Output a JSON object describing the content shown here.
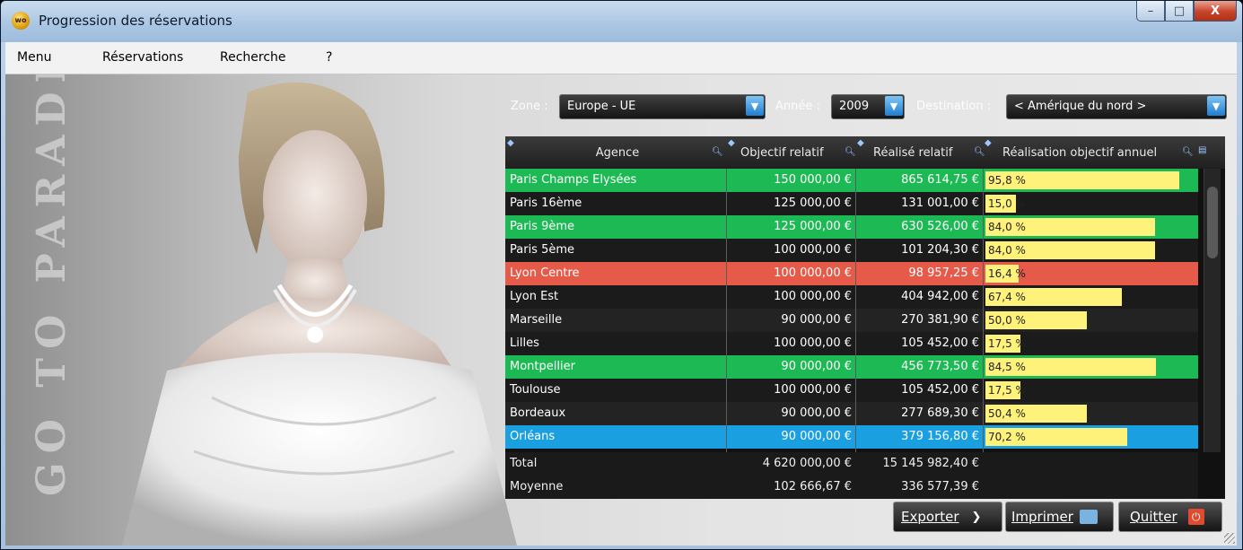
{
  "window": {
    "title": "Progression des réservations",
    "app_icon_text": "wo",
    "controls": {
      "minimize": "–",
      "maximize": "□",
      "close": "X"
    }
  },
  "menu": [
    "Menu",
    "Réservations",
    "Recherche",
    "?"
  ],
  "background": {
    "vertical_text": "GO TO PARADISE"
  },
  "filters": {
    "zone_label": "Zone :",
    "zone_value": "Europe - UE",
    "year_label": "Année :",
    "year_value": "2009",
    "destination_label": "Destination :",
    "destination_value": "< Amérique du nord >"
  },
  "table": {
    "columns": [
      "Agence",
      "Objectif relatif",
      "Réalisé relatif",
      "Réalisation objectif annuel"
    ],
    "rows": [
      {
        "agency": "Paris Champs Elysées",
        "objective": "150 000,00 €",
        "realized": "865 614,75 €",
        "pct": "95,8 %",
        "pct_value": 95.8,
        "status": "green"
      },
      {
        "agency": "Paris 16ème",
        "objective": "125 000,00 €",
        "realized": "131 001,00 €",
        "pct": "15,0 %",
        "pct_value": 15.0,
        "status": "dark"
      },
      {
        "agency": "Paris 9ème",
        "objective": "125 000,00 €",
        "realized": "630 526,00 €",
        "pct": "84,0 %",
        "pct_value": 84.0,
        "status": "green"
      },
      {
        "agency": "Paris 5ème",
        "objective": "100 000,00 €",
        "realized": "101 204,30 €",
        "pct": "84,0 %",
        "pct_value": 84.0,
        "status": "dark"
      },
      {
        "agency": "Lyon Centre",
        "objective": "100 000,00 €",
        "realized": "98 957,25 €",
        "pct": "16,4 %",
        "pct_value": 16.4,
        "status": "red"
      },
      {
        "agency": "Lyon Est",
        "objective": "100 000,00 €",
        "realized": "404 942,00 €",
        "pct": "67,4 %",
        "pct_value": 67.4,
        "status": "dark"
      },
      {
        "agency": "Marseille",
        "objective": "90 000,00 €",
        "realized": "270 381,90 €",
        "pct": "50,0 %",
        "pct_value": 50.0,
        "status": "dark"
      },
      {
        "agency": "Lilles",
        "objective": "100 000,00 €",
        "realized": "105 452,00 €",
        "pct": "17,5 %",
        "pct_value": 17.5,
        "status": "dark"
      },
      {
        "agency": "Montpellier",
        "objective": "90 000,00 €",
        "realized": "456 773,50 €",
        "pct": "84,5 %",
        "pct_value": 84.5,
        "status": "green"
      },
      {
        "agency": "Toulouse",
        "objective": "100 000,00 €",
        "realized": "105 452,00 €",
        "pct": "17,5 %",
        "pct_value": 17.5,
        "status": "dark"
      },
      {
        "agency": "Bordeaux",
        "objective": "90 000,00 €",
        "realized": "277 689,30 €",
        "pct": "50,4 %",
        "pct_value": 50.4,
        "status": "dark"
      },
      {
        "agency": "Orléans",
        "objective": "90 000,00 €",
        "realized": "379 156,80 €",
        "pct": "70,2 %",
        "pct_value": 70.2,
        "status": "selected"
      }
    ],
    "footer": [
      {
        "label": "Total",
        "objective": "4 620 000,00 €",
        "realized": "15 145 982,40 €"
      },
      {
        "label": "Moyenne",
        "objective": "102 666,67 €",
        "realized": "336 577,39 €"
      }
    ]
  },
  "buttons": {
    "export": "Exporter",
    "print": "Imprimer",
    "quit": "Quitter"
  },
  "colors": {
    "green": "#1db954",
    "red": "#e65a4a",
    "selected": "#1aa0e0",
    "dark": "#1b1b1b",
    "bar": "#fff27a"
  }
}
